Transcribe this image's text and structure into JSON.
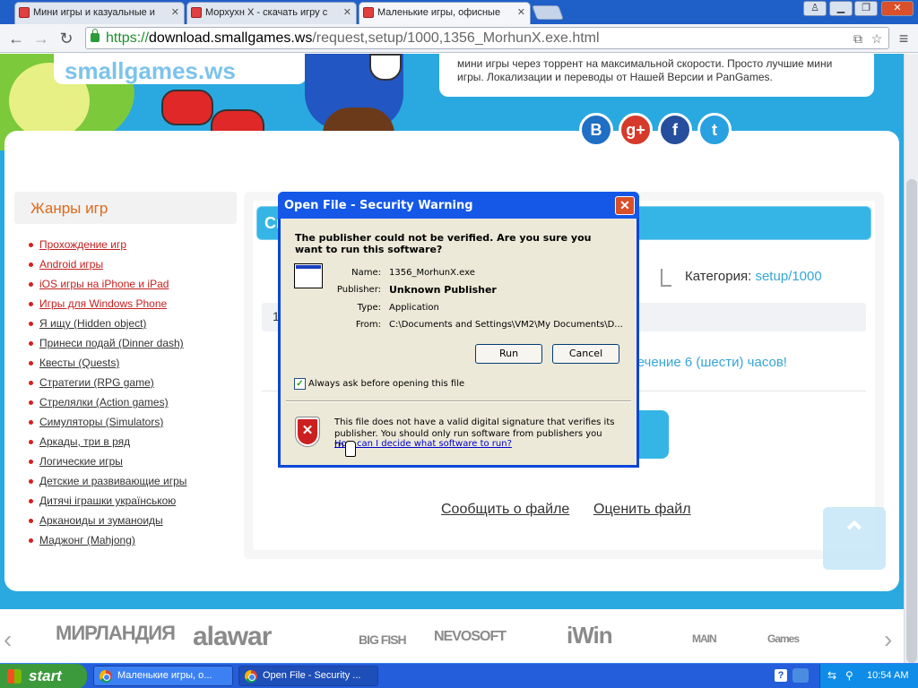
{
  "browser": {
    "tabs": [
      {
        "title": "Мини игры и казуальные и"
      },
      {
        "title": "Морхухн X - скачать игру с"
      },
      {
        "title": "Маленькие игры, офисные"
      }
    ],
    "url": {
      "scheme": "https://",
      "host": "download.smallgames.ws",
      "path": "/request,setup/1000,1356_MorhunX.exe.html"
    }
  },
  "site": {
    "logo": "smallgames.ws",
    "description": "мини игры через торрент на максимальной скорости. Просто лучшие мини игры. Локализации и переводы от Нашей Версии и PanGames.",
    "social": [
      {
        "label": "B",
        "color": "#1f6fc4"
      },
      {
        "label": "g+",
        "color": "#d63a2a"
      },
      {
        "label": "f",
        "color": "#274e9c"
      },
      {
        "label": "t",
        "color": "#29a0e0"
      }
    ],
    "sidebar": {
      "title": "Жанры игр",
      "items": [
        {
          "label": "Прохождение игр",
          "red": true
        },
        {
          "label": "Android игры",
          "red": true
        },
        {
          "label": "iOS игры на iPhone и iPad",
          "red": true
        },
        {
          "label": "Игры для Windows Phone",
          "red": true
        },
        {
          "label": "Я ищу (Hidden object)",
          "red": false
        },
        {
          "label": "Принеси подай (Dinner dash)",
          "red": false
        },
        {
          "label": "Квесты (Quests)",
          "red": false
        },
        {
          "label": "Стратегии (RPG game)",
          "red": false
        },
        {
          "label": "Стрелялки (Action games)",
          "red": false
        },
        {
          "label": "Симуляторы (Simulators)",
          "red": false
        },
        {
          "label": "Аркады, три в ряд",
          "red": false
        },
        {
          "label": "Логические игры",
          "red": false
        },
        {
          "label": "Детские и развивающие игры",
          "red": false
        },
        {
          "label": "Дитячі іграшки українською",
          "red": false
        },
        {
          "label": "Арканоиды и зуманоиды",
          "red": false
        },
        {
          "label": "Маджонг (Mahjong)",
          "red": false
        }
      ]
    },
    "main": {
      "title_partial": "Ск",
      "category_label": "Категория:",
      "category_value": "setup/1000",
      "row_partial": "1",
      "warning_partial": "течение 6 (шести) часов!",
      "report_link": "Сообщить о файле",
      "rate_link": "Оценить файл"
    },
    "partners": [
      "МИРЛАНДИЯ",
      "alawar",
      "BIG FISH",
      "NEVOSOFT",
      "iWin",
      "MAIN",
      "Games"
    ]
  },
  "dialog": {
    "title": "Open File - Security Warning",
    "question": "The publisher could not be verified.  Are you sure you want to run this software?",
    "fields": {
      "name_label": "Name:",
      "name_value": "1356_MorhunX.exe",
      "publisher_label": "Publisher:",
      "publisher_value": "Unknown Publisher",
      "type_label": "Type:",
      "type_value": "Application",
      "from_label": "From:",
      "from_value": "C:\\Documents and Settings\\VM2\\My Documents\\D..."
    },
    "run_label": "Run",
    "cancel_label": "Cancel",
    "always_ask_label": "Always ask before opening this file",
    "always_ask_checked": true,
    "warning_text": "This file does not have a valid digital signature that verifies its publisher.  You should only run software from publishers you trust.",
    "help_link": "How can I decide what software to run?"
  },
  "taskbar": {
    "start_label": "start",
    "tasks": [
      {
        "label": "Маленькие игры, о..."
      },
      {
        "label": "Open File - Security ..."
      }
    ],
    "clock": "10:54 AM"
  }
}
